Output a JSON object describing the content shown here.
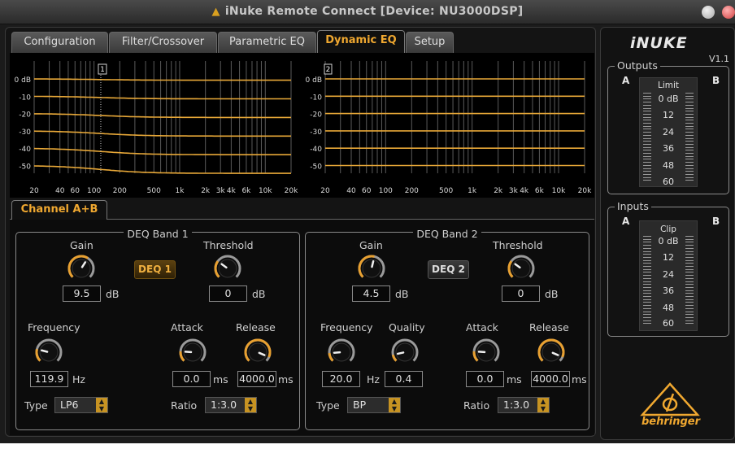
{
  "window": {
    "title": "iNuke Remote Connect [Device: NU3000DSP]"
  },
  "tabs": [
    {
      "label": "Configuration",
      "active": false
    },
    {
      "label": "Filter/Crossover",
      "active": false
    },
    {
      "label": "Parametric EQ",
      "active": false
    },
    {
      "label": "Dynamic EQ",
      "active": true
    },
    {
      "label": "Setup",
      "active": false
    }
  ],
  "graph": {
    "y_labels": [
      "0 dB",
      "-10",
      "-20",
      "-30",
      "-40",
      "-50"
    ],
    "x_labels": [
      "20",
      "40",
      "60",
      "100",
      "200",
      "500",
      "1k",
      "2k",
      "3k",
      "4k",
      "6k",
      "10k",
      "20k"
    ],
    "band1_marker": "1",
    "band2_marker": "2",
    "curve_color": "#e8a838"
  },
  "channel_tab": "Channel A+B",
  "band1": {
    "title": "DEQ Band 1",
    "gain_label": "Gain",
    "gain_value": "9.5",
    "gain_unit": "dB",
    "threshold_label": "Threshold",
    "threshold_value": "0",
    "threshold_unit": "dB",
    "button": "DEQ 1",
    "frequency_label": "Frequency",
    "frequency_value": "119.9",
    "frequency_unit": "Hz",
    "attack_label": "Attack",
    "attack_value": "0.0",
    "attack_unit": "ms",
    "release_label": "Release",
    "release_value": "4000.0",
    "release_unit": "ms",
    "type_label": "Type",
    "type_value": "LP6",
    "ratio_label": "Ratio",
    "ratio_value": "1:3.0"
  },
  "band2": {
    "title": "DEQ Band 2",
    "gain_label": "Gain",
    "gain_value": "4.5",
    "gain_unit": "dB",
    "threshold_label": "Threshold",
    "threshold_value": "0",
    "threshold_unit": "dB",
    "button": "DEQ 2",
    "frequency_label": "Frequency",
    "frequency_value": "20.0",
    "frequency_unit": "Hz",
    "quality_label": "Quality",
    "quality_value": "0.4",
    "attack_label": "Attack",
    "attack_value": "0.0",
    "attack_unit": "ms",
    "release_label": "Release",
    "release_value": "4000.0",
    "release_unit": "ms",
    "type_label": "Type",
    "type_value": "BP",
    "ratio_label": "Ratio",
    "ratio_value": "1:3.0"
  },
  "side": {
    "logo": "iNUKE",
    "version": "V1.1",
    "outputs": {
      "title": "Outputs",
      "a": "A",
      "b": "B",
      "meter_title": "Limit",
      "scale": [
        "0 dB",
        "12",
        "24",
        "36",
        "48",
        "60"
      ]
    },
    "inputs": {
      "title": "Inputs",
      "a": "A",
      "b": "B",
      "meter_title": "Clip",
      "scale": [
        "0 dB",
        "12",
        "24",
        "36",
        "48",
        "60"
      ]
    },
    "brand": "behringer"
  },
  "colors": {
    "accent": "#f0a830",
    "background": "#141414"
  }
}
